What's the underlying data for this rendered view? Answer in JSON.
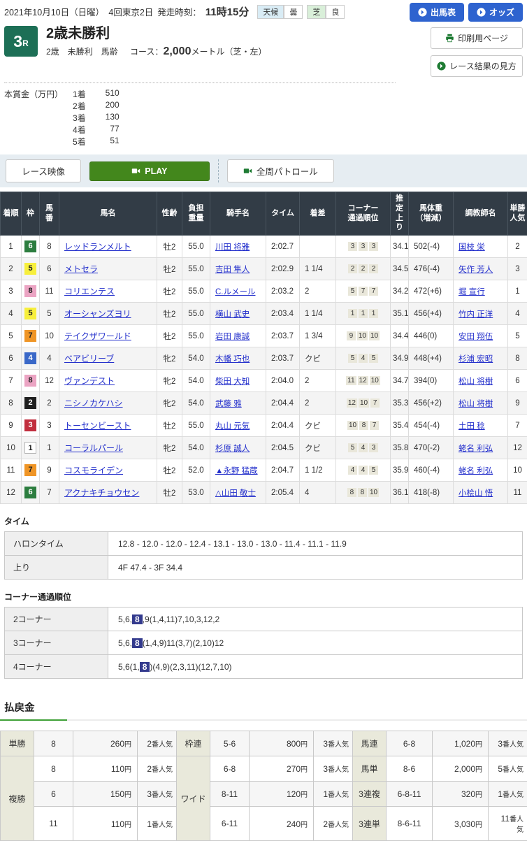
{
  "header": {
    "date_line": "2021年10月10日（日曜）　4回東京2日",
    "start_label": "発走時刻：",
    "start_time": "11時15分",
    "weather_label": "天候",
    "weather_value": "曇",
    "turf_label": "芝",
    "turf_value": "良",
    "buttons": {
      "entries": "出馬表",
      "odds": "オッズ",
      "print": "印刷用ページ",
      "guide": "レース結果の見方"
    }
  },
  "race": {
    "number": "3",
    "number_suffix": "R",
    "title": "2歳未勝利",
    "conditions": "2歳　未勝利　馬齢",
    "course_label": "コース：",
    "course_value": "2,000",
    "course_unit": "メートル（芝・左）",
    "prize_label": "本賞金（万円）",
    "prizes": [
      {
        "place": "1着",
        "amount": "510"
      },
      {
        "place": "2着",
        "amount": "200"
      },
      {
        "place": "3着",
        "amount": "130"
      },
      {
        "place": "4着",
        "amount": "77"
      },
      {
        "place": "5着",
        "amount": "51"
      }
    ]
  },
  "video": {
    "race_video_label": "レース映像",
    "play_label": "PLAY",
    "patrol_label": "全周パトロール"
  },
  "results": {
    "headers": [
      "着順",
      "枠",
      "馬\n番",
      "馬名",
      "性齢",
      "負担\n重量",
      "騎手名",
      "タイム",
      "着差",
      "コーナー\n通過順位",
      "推\n定\n上\nり",
      "馬体重\n（増減）",
      "調教師名",
      "単勝\n人気"
    ],
    "rows": [
      {
        "pos": "1",
        "frame": "6",
        "num": "8",
        "horse": "レッドランメルト",
        "sexage": "牡2",
        "weight": "55.0",
        "jockey": "川田 将雅",
        "time": "2:02.7",
        "margin": "",
        "corners": [
          "3",
          "3",
          "3"
        ],
        "last3f": "34.1",
        "body": "502(-4)",
        "trainer": "国枝 栄",
        "pop": "2"
      },
      {
        "pos": "2",
        "frame": "5",
        "num": "6",
        "horse": "メトセラ",
        "sexage": "牡2",
        "weight": "55.0",
        "jockey": "吉田 隼人",
        "time": "2:02.9",
        "margin": "1 1/4",
        "corners": [
          "2",
          "2",
          "2"
        ],
        "last3f": "34.5",
        "body": "476(-4)",
        "trainer": "矢作 芳人",
        "pop": "3"
      },
      {
        "pos": "3",
        "frame": "8",
        "num": "11",
        "horse": "コリエンテス",
        "sexage": "牡2",
        "weight": "55.0",
        "jockey": "C.ルメール",
        "time": "2:03.2",
        "margin": "2",
        "corners": [
          "5",
          "7",
          "7"
        ],
        "last3f": "34.2",
        "body": "472(+6)",
        "trainer": "堀 宣行",
        "pop": "1"
      },
      {
        "pos": "4",
        "frame": "5",
        "num": "5",
        "horse": "オーシャンズヨリ",
        "sexage": "牡2",
        "weight": "55.0",
        "jockey": "横山 武史",
        "time": "2:03.4",
        "margin": "1 1/4",
        "corners": [
          "1",
          "1",
          "1"
        ],
        "last3f": "35.1",
        "body": "456(+4)",
        "trainer": "竹内 正洋",
        "pop": "4"
      },
      {
        "pos": "5",
        "frame": "7",
        "num": "10",
        "horse": "テイクザワールド",
        "sexage": "牡2",
        "weight": "55.0",
        "jockey": "岩田 康誠",
        "time": "2:03.7",
        "margin": "1 3/4",
        "corners": [
          "9",
          "10",
          "10"
        ],
        "last3f": "34.4",
        "body": "446(0)",
        "trainer": "安田 翔伍",
        "pop": "5"
      },
      {
        "pos": "6",
        "frame": "4",
        "num": "4",
        "horse": "ベアビリーブ",
        "sexage": "牝2",
        "weight": "54.0",
        "jockey": "木幡 巧也",
        "time": "2:03.7",
        "margin": "クビ",
        "corners": [
          "5",
          "4",
          "5"
        ],
        "last3f": "34.9",
        "body": "448(+4)",
        "trainer": "杉浦 宏昭",
        "pop": "8"
      },
      {
        "pos": "7",
        "frame": "8",
        "num": "12",
        "horse": "ヴァンデスト",
        "sexage": "牝2",
        "weight": "54.0",
        "jockey": "柴田 大知",
        "time": "2:04.0",
        "margin": "2",
        "corners": [
          "11",
          "12",
          "10"
        ],
        "last3f": "34.7",
        "body": "394(0)",
        "trainer": "松山 将樹",
        "pop": "6"
      },
      {
        "pos": "8",
        "frame": "2",
        "num": "2",
        "horse": "ニシノカケハシ",
        "sexage": "牝2",
        "weight": "54.0",
        "jockey": "武藤 雅",
        "time": "2:04.4",
        "margin": "2",
        "corners": [
          "12",
          "10",
          "7"
        ],
        "last3f": "35.3",
        "body": "456(+2)",
        "trainer": "松山 将樹",
        "pop": "9"
      },
      {
        "pos": "9",
        "frame": "3",
        "num": "3",
        "horse": "トーセンビースト",
        "sexage": "牡2",
        "weight": "55.0",
        "jockey": "丸山 元気",
        "time": "2:04.4",
        "margin": "クビ",
        "corners": [
          "10",
          "8",
          "7"
        ],
        "last3f": "35.4",
        "body": "454(-4)",
        "trainer": "土田 稔",
        "pop": "7"
      },
      {
        "pos": "10",
        "frame": "1",
        "num": "1",
        "horse": "コーラルパール",
        "sexage": "牝2",
        "weight": "54.0",
        "jockey": "杉原 誠人",
        "time": "2:04.5",
        "margin": "クビ",
        "corners": [
          "5",
          "4",
          "3"
        ],
        "last3f": "35.8",
        "body": "470(-2)",
        "trainer": "蛯名 利弘",
        "pop": "12"
      },
      {
        "pos": "11",
        "frame": "7",
        "num": "9",
        "horse": "コスモライデン",
        "sexage": "牡2",
        "weight": "52.0",
        "jockey": "▲永野 猛蔵",
        "time": "2:04.7",
        "margin": "1 1/2",
        "corners": [
          "4",
          "4",
          "5"
        ],
        "last3f": "35.9",
        "body": "460(-4)",
        "trainer": "蛯名 利弘",
        "pop": "10"
      },
      {
        "pos": "12",
        "frame": "6",
        "num": "7",
        "horse": "アクナキチョウセン",
        "sexage": "牡2",
        "weight": "53.0",
        "jockey": "△山田 敬士",
        "time": "2:05.4",
        "margin": "4",
        "corners": [
          "8",
          "8",
          "10"
        ],
        "last3f": "36.1",
        "body": "418(-8)",
        "trainer": "小桧山 悟",
        "pop": "11"
      }
    ]
  },
  "time_section": {
    "title": "タイム",
    "rows": [
      {
        "label": "ハロンタイム",
        "value": "12.8 - 12.0 - 12.0 - 12.4 - 13.1 - 13.0 - 13.0 - 11.4 - 11.1 - 11.9"
      },
      {
        "label": "上り",
        "value": "4F 47.4 - 3F 34.4"
      }
    ]
  },
  "corner_section": {
    "title": "コーナー通過順位",
    "rows": [
      {
        "label": "2コーナー",
        "segments": [
          {
            "text": "5,6,"
          },
          {
            "text": "8",
            "highlight": true
          },
          {
            "text": ",9(1,4,11)7,10,3,12,2"
          }
        ]
      },
      {
        "label": "3コーナー",
        "segments": [
          {
            "text": "5,6,"
          },
          {
            "text": "8",
            "highlight": true
          },
          {
            "text": "(1,4,9)11(3,7)(2,10)12"
          }
        ]
      },
      {
        "label": "4コーナー",
        "segments": [
          {
            "text": "5,6(1,"
          },
          {
            "text": "8",
            "highlight": true
          },
          {
            "text": ")(4,9)(2,3,11)(12,7,10)"
          }
        ]
      }
    ]
  },
  "payout": {
    "title": "払戻金",
    "yen_suffix": "円",
    "pop_suffix": "番人気",
    "accent_color": "#3fa037",
    "groups": [
      {
        "rows": [
          {
            "label": "単勝",
            "rowspan": 1,
            "combo": "8",
            "amount": "260",
            "pop": "2"
          },
          {
            "label": "複勝",
            "rowspan": 3,
            "combo": "8",
            "amount": "110",
            "pop": "2"
          },
          {
            "combo": "6",
            "amount": "150",
            "pop": "3",
            "sub": true
          },
          {
            "combo": "11",
            "amount": "110",
            "pop": "1",
            "sub": true
          }
        ]
      },
      {
        "rows": [
          {
            "label": "枠連",
            "rowspan": 1,
            "combo": "5-6",
            "amount": "800",
            "pop": "3"
          },
          {
            "label": "ワイド",
            "rowspan": 3,
            "combo": "6-8",
            "amount": "270",
            "pop": "3"
          },
          {
            "combo": "8-11",
            "amount": "120",
            "pop": "1",
            "sub": true
          },
          {
            "combo": "6-11",
            "amount": "240",
            "pop": "2",
            "sub": true
          }
        ]
      },
      {
        "rows": [
          {
            "label": "馬連",
            "rowspan": 1,
            "combo": "6-8",
            "amount": "1,020",
            "pop": "3"
          },
          {
            "label": "馬単",
            "rowspan": 1,
            "combo": "8-6",
            "amount": "2,000",
            "pop": "5"
          },
          {
            "label": "3連複",
            "rowspan": 1,
            "combo": "6-8-11",
            "amount": "320",
            "pop": "1"
          },
          {
            "label": "3連単",
            "rowspan": 1,
            "combo": "8-6-11",
            "amount": "3,030",
            "pop": "11"
          }
        ]
      }
    ]
  }
}
